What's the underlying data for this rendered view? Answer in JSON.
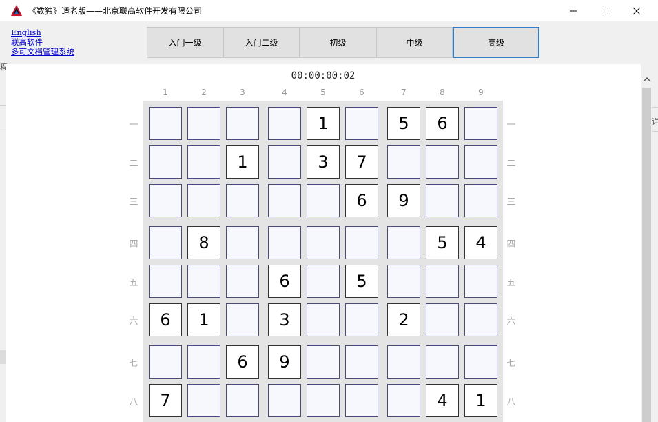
{
  "window": {
    "title": "《数独》适老版——北京联高软件开发有限公司"
  },
  "links": {
    "english": "English",
    "company": "联高软件",
    "doc_system": "多可文档管理系统"
  },
  "levels": [
    {
      "label": "入门一级",
      "active": false
    },
    {
      "label": "入门二级",
      "active": false
    },
    {
      "label": "初级",
      "active": false
    },
    {
      "label": "中级",
      "active": false
    },
    {
      "label": "高级",
      "active": true
    }
  ],
  "timer": "00:00:00:02",
  "columns": [
    "1",
    "2",
    "3",
    "4",
    "5",
    "6",
    "7",
    "8",
    "9"
  ],
  "rows": [
    "一",
    "二",
    "三",
    "四",
    "五",
    "六",
    "七",
    "八"
  ],
  "fragments": {
    "left_top": "程",
    "right_mid": "详"
  },
  "grid": [
    [
      "",
      "",
      "",
      "",
      "1",
      "",
      "5",
      "6",
      ""
    ],
    [
      "",
      "",
      "1",
      "",
      "3",
      "7",
      "",
      "",
      ""
    ],
    [
      "",
      "",
      "",
      "",
      "",
      "6",
      "9",
      "",
      ""
    ],
    [
      "",
      "8",
      "",
      "",
      "",
      "",
      "",
      "5",
      "4"
    ],
    [
      "",
      "",
      "",
      "6",
      "",
      "5",
      "",
      "",
      ""
    ],
    [
      "6",
      "1",
      "",
      "3",
      "",
      "",
      "2",
      "",
      ""
    ],
    [
      "",
      "",
      "6",
      "9",
      "",
      "",
      "",
      "",
      ""
    ],
    [
      "7",
      "",
      "",
      "",
      "",
      "",
      "",
      "4",
      "1"
    ]
  ]
}
